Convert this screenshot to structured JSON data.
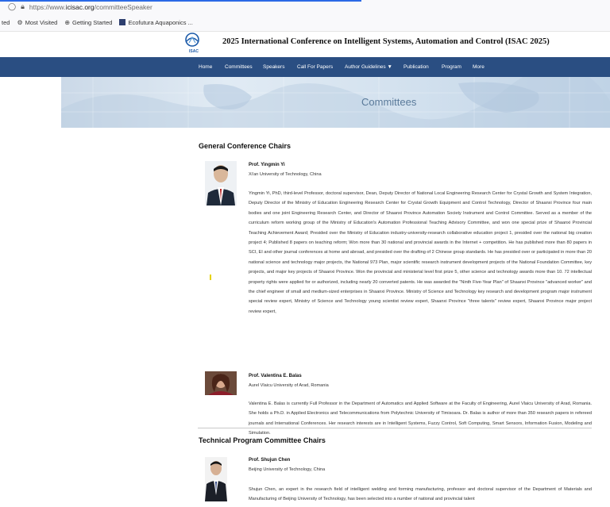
{
  "browser": {
    "url_prefix": "https://www.",
    "url_host": "icisac.org",
    "url_path": "/committeeSpeaker",
    "bookmarks": [
      "ted",
      "Most Visited",
      "Getting Started",
      "Ecofutura Aquaponics ..."
    ]
  },
  "header": {
    "logo_text": "ISAC",
    "title": "2025 International Conference on Intelligent Systems, Automation and Control (ISAC 2025)"
  },
  "nav": {
    "items": [
      "Home",
      "Committees",
      "Speakers",
      "Call For Papers",
      "Author Guidelines ▼",
      "Publication",
      "Program",
      "More"
    ]
  },
  "banner": {
    "title": "Committees"
  },
  "sections": [
    {
      "title": "General Conference Chairs",
      "people": [
        {
          "name": "Prof. Yingmin Yi",
          "affiliation": "Xi'an University of Technology, China",
          "bio": "Yingmin Yi, PhD, third-level Professor, doctoral supervisor, Dean, Deputy Director of National Local Engineering Research Center for Crystal Growth and System Integration, Deputy Director of the Ministry of Education Engineering Research Center for Crystal Growth Equipment and Control Technology, Director of Shaanxi Province four main bodies and one joint Engineering Research Center, and Director of Shaanxi Province Automation Society Instrument and Control Committee. Served as a member of the curriculum reform working group of the Ministry of Education's Automation Professional Teaching Advisory Committee, and won one special prize of Shaanxi Provincial Teaching Achievement Award; Presided over the Ministry of Education industry-university-research collaborative education project 1, presided over the national big creation project 4; Published 8 papers on teaching reform; Won more than 30 national and provincial awards in the Internet + competition. He has published more than 80 papers in SCI, EI and other journal conferences at home and abroad, and presided over the drafting of 2 Chinese group standards. He has presided over or participated in more than 20 national science and technology major projects, the National 973 Plan, major scientific research instrument development projects of the National Foundation Committee, key projects, and major key projects of Shaanxi Province. Won the provincial and ministerial level first prize 5, other science and technology awards more than 10. 72 intellectual property rights were applied for or authorized, including nearly 20 converted patents. He was awarded the \"Ninth Five-Year Plan\" of Shaanxi Province \"advanced worker\" and the chief engineer of small and medium-sized enterprises in Shaanxi Province. Ministry of Science and Technology key research and development program major instrument special review expert, Ministry of Science and Technology young scientist review expert, Shaanxi Province \"three talents\" review expert, Shaanxi Province major project review expert,"
        },
        {
          "name": "Prof. Valentina E. Balas",
          "affiliation": "Aurel Vlaicu University of Arad, Romania",
          "bio": "Valentina E. Balas is currently Full Professor in the Department of Automatics and Applied Software at the Faculty of Engineering, Aurel Vlaicu University of Arad, Romania. She holds a Ph.D. in Applied Electronics and Telecommunications from Polytechnic University of Timisoara. Dr. Balas is author of more than 350 research papers in refereed journals and International Conferences. Her research interests are in Intelligent Systems, Fuzzy Control, Soft Computing, Smart Sensors, Information Fusion, Modeling and Simulation."
        }
      ]
    },
    {
      "title": "Technical Program Committee Chairs",
      "people": [
        {
          "name": "Prof. Shujun Chen",
          "affiliation": "Beijing University of Technology, China",
          "bio": "Shujun Chen, an expert in the research field of intelligent welding and forming manufacturing, professor and doctoral supervisor of the Department of Materials and Manufacturing of Beijing University of Technology, has been selected into a number of national and provincial talent"
        }
      ]
    }
  ]
}
